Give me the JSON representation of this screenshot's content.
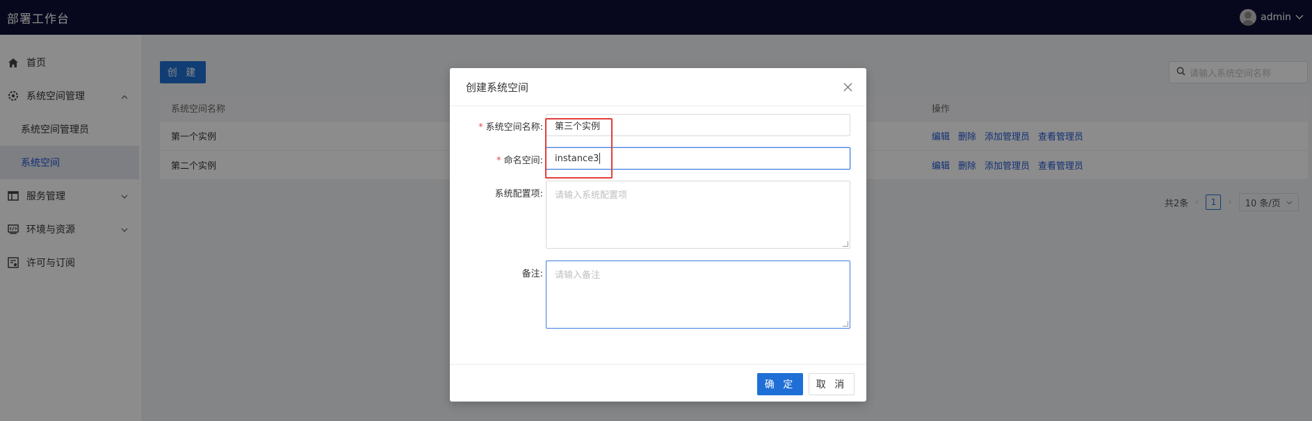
{
  "header": {
    "title": "部署工作台",
    "user": "admin"
  },
  "sidebar": {
    "items": [
      {
        "label": "首页",
        "icon": "home-icon"
      },
      {
        "label": "系统空间管理",
        "icon": "gear-icon",
        "expanded": true
      },
      {
        "label": "系统空间管理员",
        "sub": true
      },
      {
        "label": "系统空间",
        "sub": true,
        "active": true
      },
      {
        "label": "服务管理",
        "icon": "table-icon"
      },
      {
        "label": "环境与资源",
        "icon": "code-icon"
      },
      {
        "label": "许可与订阅",
        "icon": "license-icon"
      }
    ]
  },
  "toolbar": {
    "create_label": "创 建",
    "search_placeholder": "请输入系统空间名称"
  },
  "table": {
    "headers": [
      "系统空间名称",
      "操作"
    ],
    "rows": [
      {
        "name": "第一个实例",
        "actions": [
          "编辑",
          "删除",
          "添加管理员",
          "查看管理员"
        ]
      },
      {
        "name": "第二个实例",
        "actions": [
          "编辑",
          "删除",
          "添加管理员",
          "查看管理员"
        ]
      }
    ]
  },
  "pagination": {
    "total": "共2条",
    "current": "1",
    "page_size": "10 条/页"
  },
  "modal": {
    "title": "创建系统空间",
    "fields": {
      "name_label": "系统空间名称:",
      "name_value": "第三个实例",
      "namespace_label": "命名空间:",
      "namespace_value": "instance3",
      "config_label": "系统配置项:",
      "config_placeholder": "请输入系统配置项",
      "note_label": "备注:",
      "note_placeholder": "请输入备注"
    },
    "ok_label": "确 定",
    "cancel_label": "取 消"
  },
  "colors": {
    "header_bg": "#0e0f35",
    "primary": "#1f6fd6",
    "link": "#1f57d3",
    "required": "#e84749",
    "highlight": "#e23b3b"
  }
}
